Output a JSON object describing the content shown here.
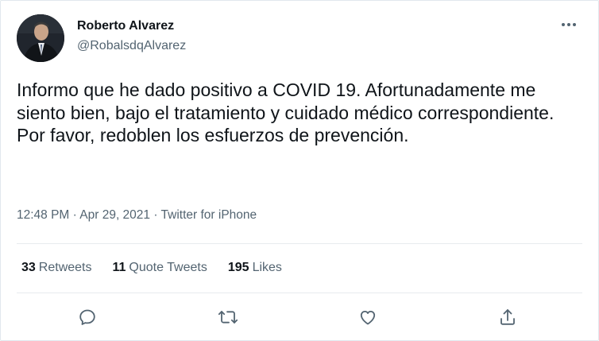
{
  "author": {
    "name": "Roberto Alvarez",
    "handle": "@RobalsdqAlvarez"
  },
  "tweet": {
    "text": "Informo que he dado positivo a COVID 19. Afortunadamente me siento bien, bajo el tratamiento y cuidado médico correspondiente. Por favor, redoblen los esfuerzos de prevención.",
    "time": "12:48 PM",
    "sep1": " · ",
    "date": "Apr 29, 2021",
    "sep2": " · ",
    "source": "Twitter for iPhone"
  },
  "stats": {
    "retweets_count": "33",
    "retweets_label": "Retweets",
    "quotes_count": "11",
    "quotes_label": "Quote Tweets",
    "likes_count": "195",
    "likes_label": "Likes"
  },
  "icons": {
    "more": "more-horizontal-icon",
    "reply": "reply-icon",
    "retweet": "retweet-icon",
    "like": "heart-icon",
    "share": "share-icon"
  },
  "colors": {
    "text": "#0f1419",
    "secondary": "#536471",
    "divider": "#e7ebee"
  }
}
